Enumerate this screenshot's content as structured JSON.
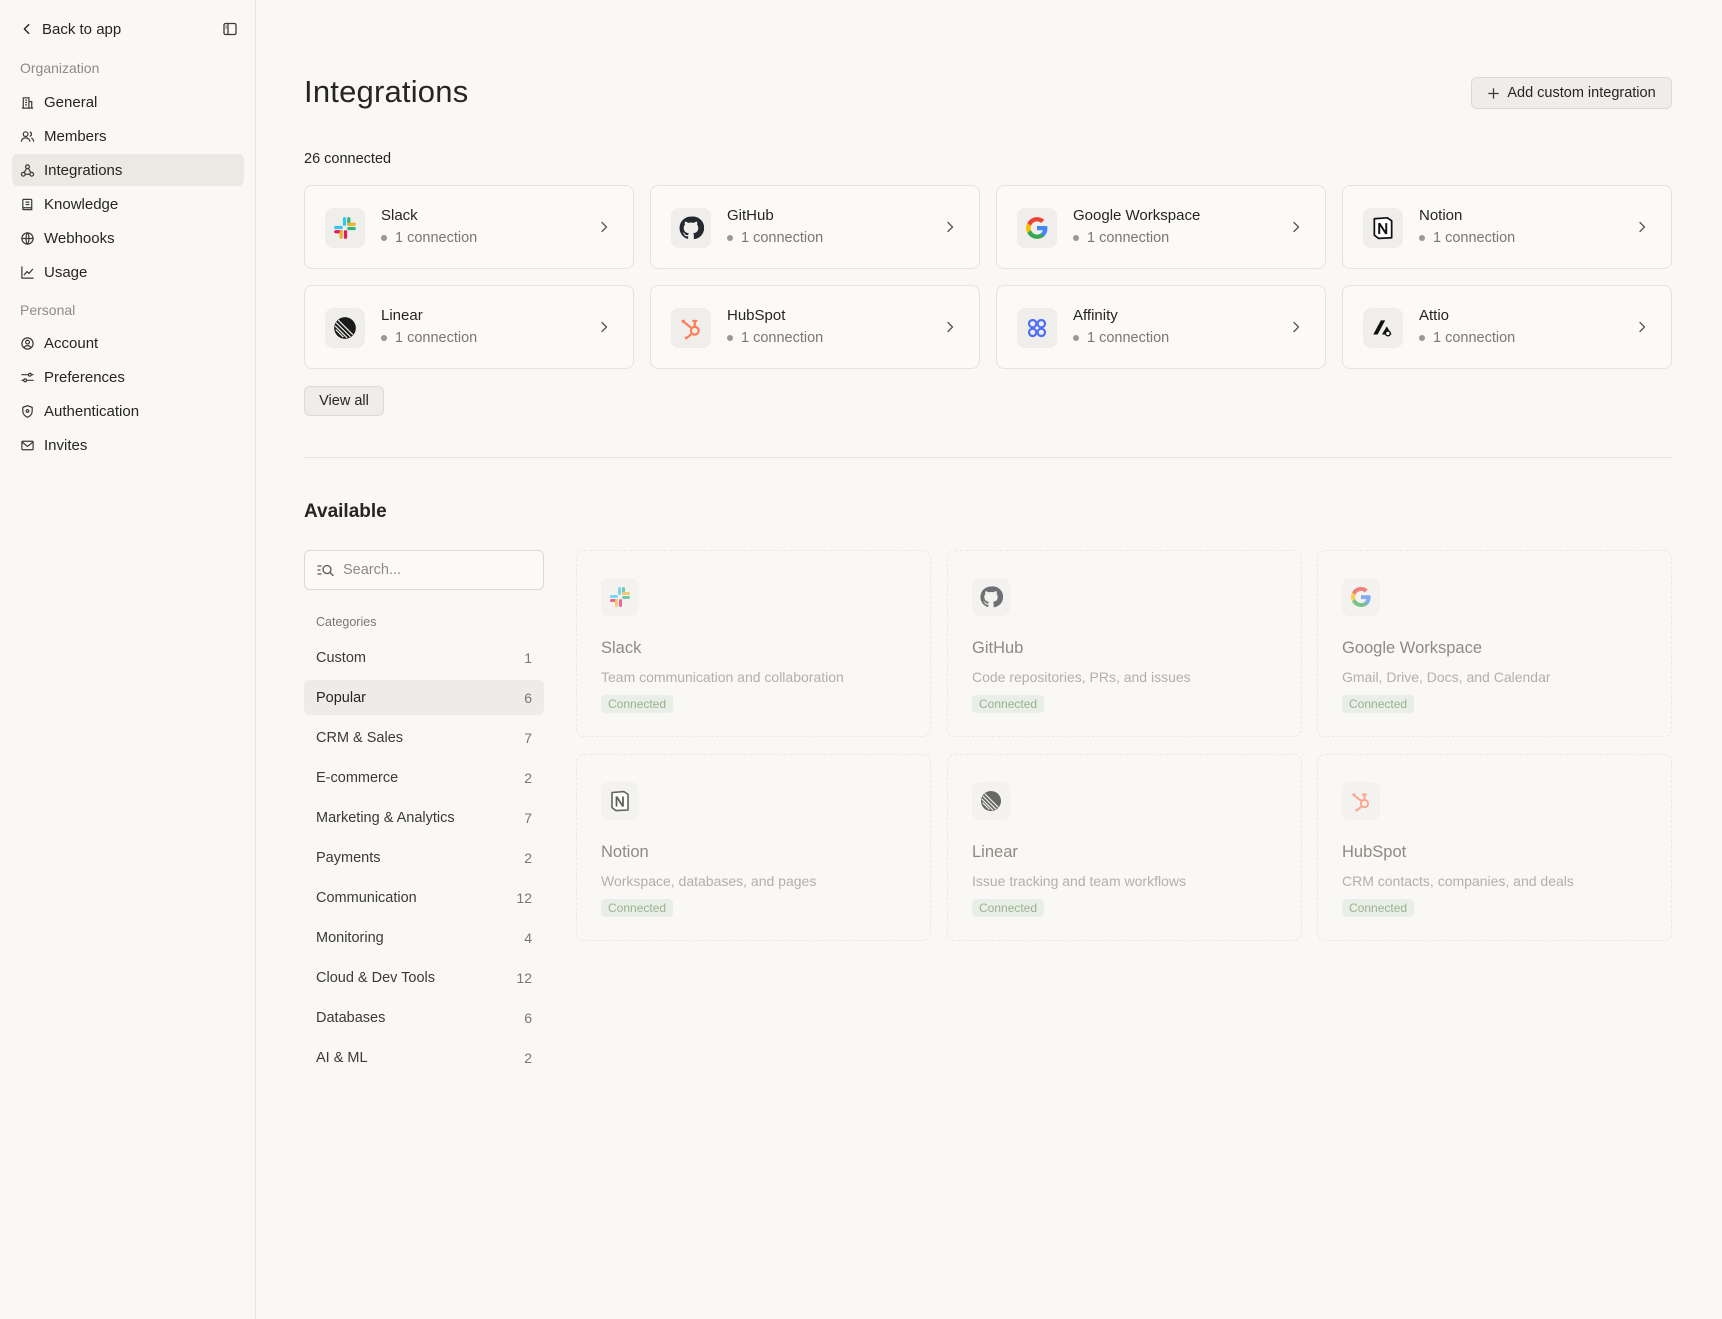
{
  "sidebar": {
    "back_label": "Back to app",
    "sections": [
      {
        "label": "Organization"
      },
      {
        "label": "Personal"
      }
    ],
    "items": [
      {
        "label": "General",
        "icon": "building-icon"
      },
      {
        "label": "Members",
        "icon": "users-icon"
      },
      {
        "label": "Integrations",
        "icon": "integrations-icon",
        "active": true
      },
      {
        "label": "Knowledge",
        "icon": "book-icon"
      },
      {
        "label": "Webhooks",
        "icon": "globe-icon"
      },
      {
        "label": "Usage",
        "icon": "chart-icon"
      },
      {
        "label": "Account",
        "icon": "user-circle-icon"
      },
      {
        "label": "Preferences",
        "icon": "sliders-icon"
      },
      {
        "label": "Authentication",
        "icon": "shield-icon"
      },
      {
        "label": "Invites",
        "icon": "mail-icon"
      }
    ]
  },
  "header": {
    "title": "Integrations",
    "add_button_label": "Add custom integration"
  },
  "connected": {
    "count_label": "26 connected",
    "cards": [
      {
        "name": "Slack",
        "status": "1 connection",
        "icon": "slack-icon"
      },
      {
        "name": "GitHub",
        "status": "1 connection",
        "icon": "github-icon"
      },
      {
        "name": "Google Workspace",
        "status": "1 connection",
        "icon": "google-icon"
      },
      {
        "name": "Notion",
        "status": "1 connection",
        "icon": "notion-icon"
      },
      {
        "name": "Linear",
        "status": "1 connection",
        "icon": "linear-icon"
      },
      {
        "name": "HubSpot",
        "status": "1 connection",
        "icon": "hubspot-icon"
      },
      {
        "name": "Affinity",
        "status": "1 connection",
        "icon": "affinity-icon"
      },
      {
        "name": "Attio",
        "status": "1 connection",
        "icon": "attio-icon"
      }
    ],
    "view_all_label": "View all"
  },
  "available": {
    "title": "Available",
    "search": {
      "placeholder": "Search...",
      "value": ""
    },
    "categories_label": "Categories",
    "categories": [
      {
        "label": "Custom",
        "count": "1"
      },
      {
        "label": "Popular",
        "count": "6",
        "active": true
      },
      {
        "label": "CRM & Sales",
        "count": "7"
      },
      {
        "label": "E-commerce",
        "count": "2"
      },
      {
        "label": "Marketing & Analytics",
        "count": "7"
      },
      {
        "label": "Payments",
        "count": "2"
      },
      {
        "label": "Communication",
        "count": "12"
      },
      {
        "label": "Monitoring",
        "count": "4"
      },
      {
        "label": "Cloud & Dev Tools",
        "count": "12"
      },
      {
        "label": "Databases",
        "count": "6"
      },
      {
        "label": "AI & ML",
        "count": "2"
      }
    ],
    "cards": [
      {
        "name": "Slack",
        "description": "Team communication and collaboration",
        "badge": "Connected",
        "icon": "slack-icon"
      },
      {
        "name": "GitHub",
        "description": "Code repositories, PRs, and issues",
        "badge": "Connected",
        "icon": "github-icon"
      },
      {
        "name": "Google Workspace",
        "description": "Gmail, Drive, Docs, and Calendar",
        "badge": "Connected",
        "icon": "google-icon"
      },
      {
        "name": "Notion",
        "description": "Workspace, databases, and pages",
        "badge": "Connected",
        "icon": "notion-icon"
      },
      {
        "name": "Linear",
        "description": "Issue tracking and team workflows",
        "badge": "Connected",
        "icon": "linear-icon"
      },
      {
        "name": "HubSpot",
        "description": "CRM contacts, companies, and deals",
        "badge": "Connected",
        "icon": "hubspot-icon"
      }
    ]
  },
  "colors": {
    "background": "#f9f8f6",
    "active_nav": "#ebe9e4",
    "hubspot": "#ff7a59",
    "affinity": "#4f6ef7",
    "connected_badge_bg": "#e9efe6",
    "connected_badge_text": "#99b190"
  }
}
